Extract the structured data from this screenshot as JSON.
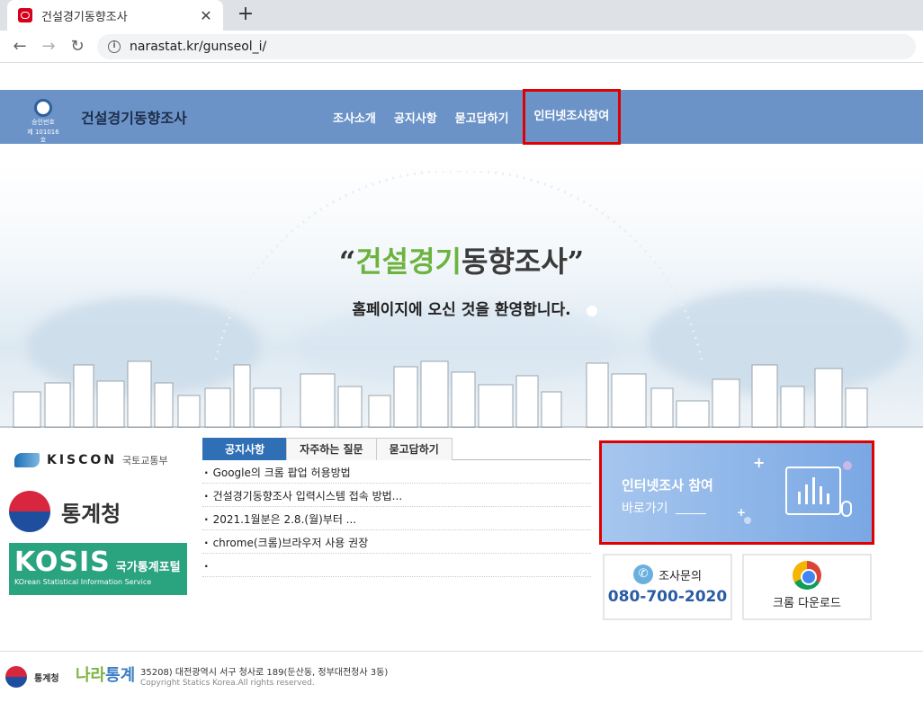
{
  "browser": {
    "tab_title": "건설경기동향조사",
    "tab_close": "✕",
    "new_tab": "+",
    "url": "narastat.kr/gunseol_i/",
    "back": "←",
    "forward": "→",
    "reload": "↻",
    "info": "i"
  },
  "header": {
    "seal_line1": "승인번호",
    "seal_line2": "제 101016 호",
    "site_title": "건설경기동향조사",
    "nav": [
      "조사소개",
      "공지사항",
      "묻고답하기",
      "인터넷조사참여"
    ]
  },
  "hero": {
    "open_quote": "“",
    "title_green": "건설경기",
    "title_dark": "동향조사",
    "close_quote": "”",
    "subtitle": "홈페이지에 오신 것을 환영합니다."
  },
  "logos": {
    "kiscon": "KISCON",
    "kiscon_sub": "국토교통부",
    "kostat": "통계청",
    "kosis": "KOSIS",
    "kosis_kr": "국가통계포털",
    "kosis_en": "KOrean Statistical Information Service"
  },
  "board": {
    "tabs": [
      "공지사항",
      "자주하는 질문",
      "묻고답하기"
    ],
    "items": [
      "Google의 크롬 팝업 허용방법",
      "건설경기동향조사 입력시스템 접속 방법...",
      "2021.1월분은 2.8.(월)부터 ...",
      "chrome(크롬)브라우저 사용 권장"
    ]
  },
  "banner": {
    "line1": "인터넷조사 참여",
    "line2": "바로가기"
  },
  "contact": {
    "label": "조사문의",
    "phone": "080-700-2020",
    "phone_icon": "✆"
  },
  "chrome_download": {
    "label": "크롬 다운로드"
  },
  "footer": {
    "kostat": "통계청",
    "nara_a": "나라",
    "nara_b": "통계",
    "address": "35208) 대전광역시 서구 청사로 189(둔산동, 정부대전청사 3동)",
    "copyright": "Copyright Statics Korea.All rights reserved."
  },
  "colors": {
    "header_bg": "#6b93c8",
    "highlight": "#e00000",
    "tab_active": "#2e6fb5",
    "kosis_green": "#2aa37f"
  }
}
